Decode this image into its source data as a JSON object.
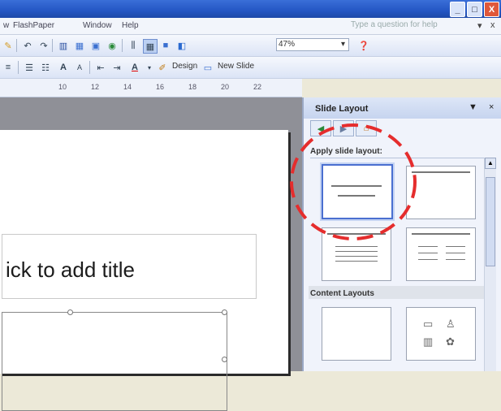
{
  "title_bar": {
    "buttons": [
      "_",
      "□",
      "X"
    ]
  },
  "menu": {
    "items": [
      "w",
      "FlashPaper",
      "Window",
      "Help"
    ],
    "help_placeholder": "Type a question for help",
    "close_symbol": "x"
  },
  "toolbar1": {
    "zoom_value": "47%"
  },
  "toolbar2": {
    "design_label": "Design",
    "new_slide_label": "New Slide"
  },
  "ruler": {
    "labels": [
      "10",
      "12",
      "14",
      "16",
      "18",
      "20",
      "22"
    ]
  },
  "slide": {
    "title_placeholder": "ick to add title"
  },
  "task_pane": {
    "title": "Slide Layout",
    "apply_label": "Apply slide layout:",
    "content_section_label": "Content Layouts"
  },
  "colors": {
    "title_bar": "#2456c4",
    "annotation_circle": "#e52d2d",
    "selected_layout_border": "#4a6fd0"
  },
  "icons": [
    "minimize-icon",
    "maximize-icon",
    "close-icon",
    "undo-icon",
    "redo-icon",
    "chart-icon",
    "zoom-dropdown-icon",
    "help-icon",
    "bold-icon",
    "font-color-icon",
    "design-icon",
    "new-slide-icon",
    "home-icon",
    "back-icon",
    "forward-icon"
  ]
}
